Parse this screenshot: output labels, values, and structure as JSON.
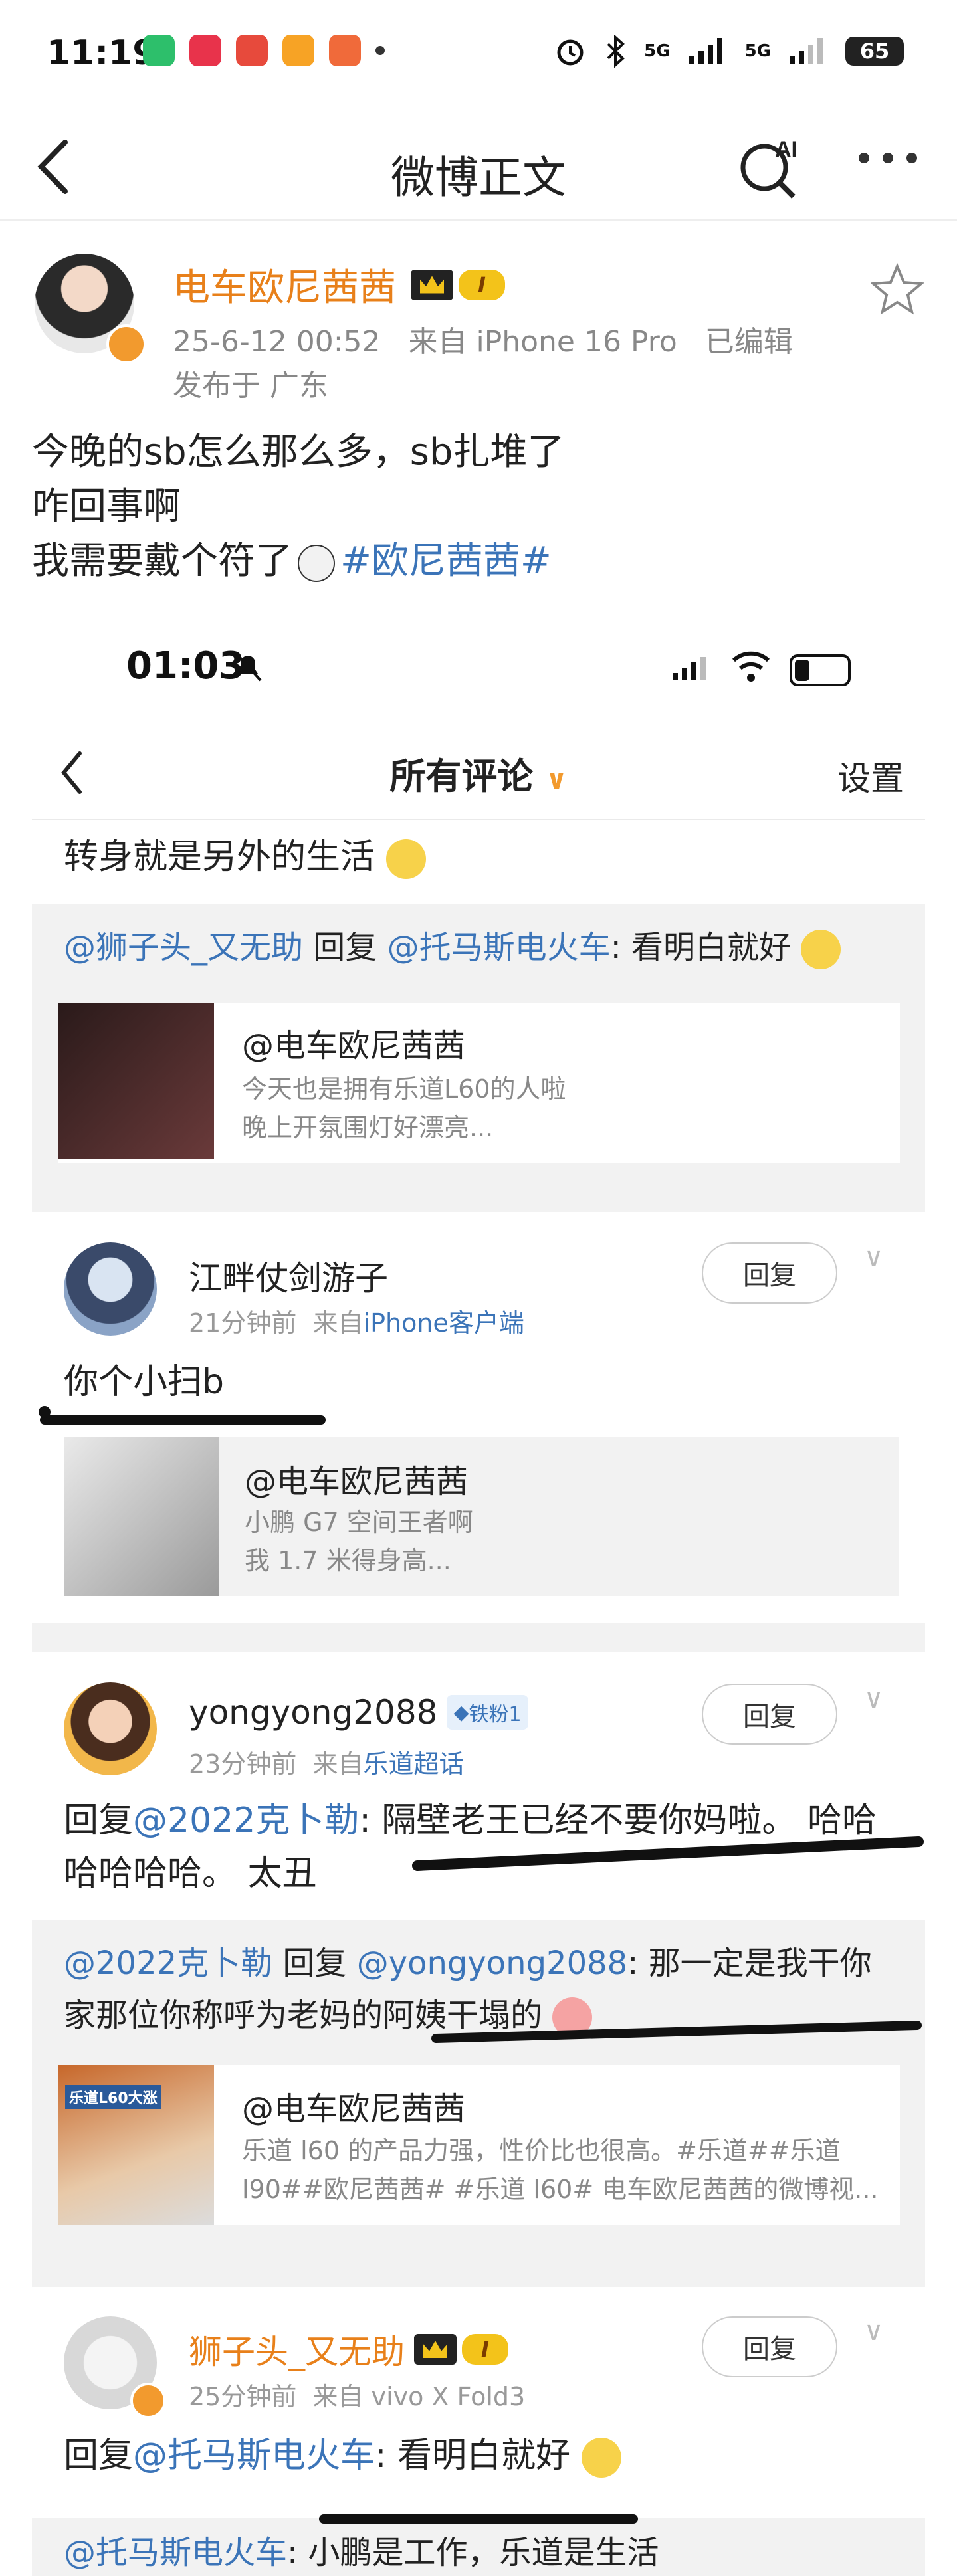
{
  "status_bar": {
    "time": "11:19",
    "apps": [
      {
        "name": "app-icon-1",
        "color": "#2dbf6b"
      },
      {
        "name": "xiaohongshu-icon",
        "color": "#e8334b",
        "label": "小红书"
      },
      {
        "name": "toutiao-icon",
        "color": "#e74a3c",
        "label": "头条"
      },
      {
        "name": "weibo-icon",
        "color": "#f7a325"
      },
      {
        "name": "app-icon-5",
        "color": "#f06a3a",
        "label": "爱奇"
      }
    ],
    "signal_1": "5G",
    "signal_2": "5G",
    "battery": "65"
  },
  "nav": {
    "title": "微博正文",
    "ai_label": "AI"
  },
  "post": {
    "author": "电车欧尼茜茜",
    "badge_level": "I",
    "date": "25-6-12 00:52",
    "source": "来自 iPhone 16 Pro",
    "edited": "已编辑",
    "location": "发布于 广东",
    "text_line_1": "今晚的sb怎么那么多，sb扎堆了",
    "text_line_2": "咋回事啊",
    "text_line_3": "我需要戴个符了",
    "hashtag": "#欧尼茜茜#"
  },
  "inner_screenshot": {
    "time": "01:03",
    "nav_title": "所有评论",
    "settings": "设置",
    "partial_comment": "转身就是另外的生活",
    "thread_1": {
      "quote_user_a": "@狮子头_又无助",
      "quote_reply_word": "回复",
      "quote_user_b": "@托马斯电火车",
      "quote_text": ": 看明白就好",
      "card_title": "@电车欧尼茜茜",
      "card_desc_1": "今天也是拥有乐道L60的人啦",
      "card_desc_2": "晚上开氛围灯好漂亮..."
    },
    "comment_2": {
      "name": "江畔仗剑游子",
      "time": "21分钟前",
      "from": "来自",
      "source": "iPhone客户端",
      "reply_btn": "回复",
      "text": "你个小扫b",
      "card_title": "@电车欧尼茜茜",
      "card_desc_1": "小鹏 G7 空间王者啊",
      "card_desc_2": "我 1.7 米得身高..."
    },
    "comment_3": {
      "name": "yongyong2088",
      "fan_badge": "铁粉1",
      "time": "23分钟前",
      "from": "来自",
      "source": "乐道超话",
      "reply_btn": "回复",
      "text_reply_word": "回复",
      "text_user": "@2022克卜勒",
      "text_body_1": ": 隔壁老王已经不要你妈啦。 哈哈",
      "text_body_2": "哈哈哈哈。 太丑",
      "quote_user_a": "@2022克卜勒",
      "quote_reply_word": "回复",
      "quote_user_b": "@yongyong2088",
      "quote_text_1": ": 那一定是我干你",
      "quote_text_2": "家那位你称呼为老妈的阿姨干塌的",
      "card_title": "@电车欧尼茜茜",
      "card_desc_1": "乐道 l60 的产品力强，性价比也很高。#乐道##乐道",
      "card_desc_2": "l90##欧尼茜茜# #乐道 l60# 电车欧尼茜茜的微博视...",
      "thumb_caption": "乐道L60大涨"
    },
    "comment_4": {
      "name": "狮子头_又无助",
      "badge_level": "I",
      "time": "25分钟前",
      "from": "来自",
      "source": "vivo X Fold3",
      "reply_btn": "回复",
      "text_reply_word": "回复",
      "text_user": "@托马斯电火车",
      "text_body": ": 看明白就好",
      "bottom_user": "@托马斯电火车",
      "bottom_text": ": 小鹏是工作，乐道是生活"
    }
  }
}
